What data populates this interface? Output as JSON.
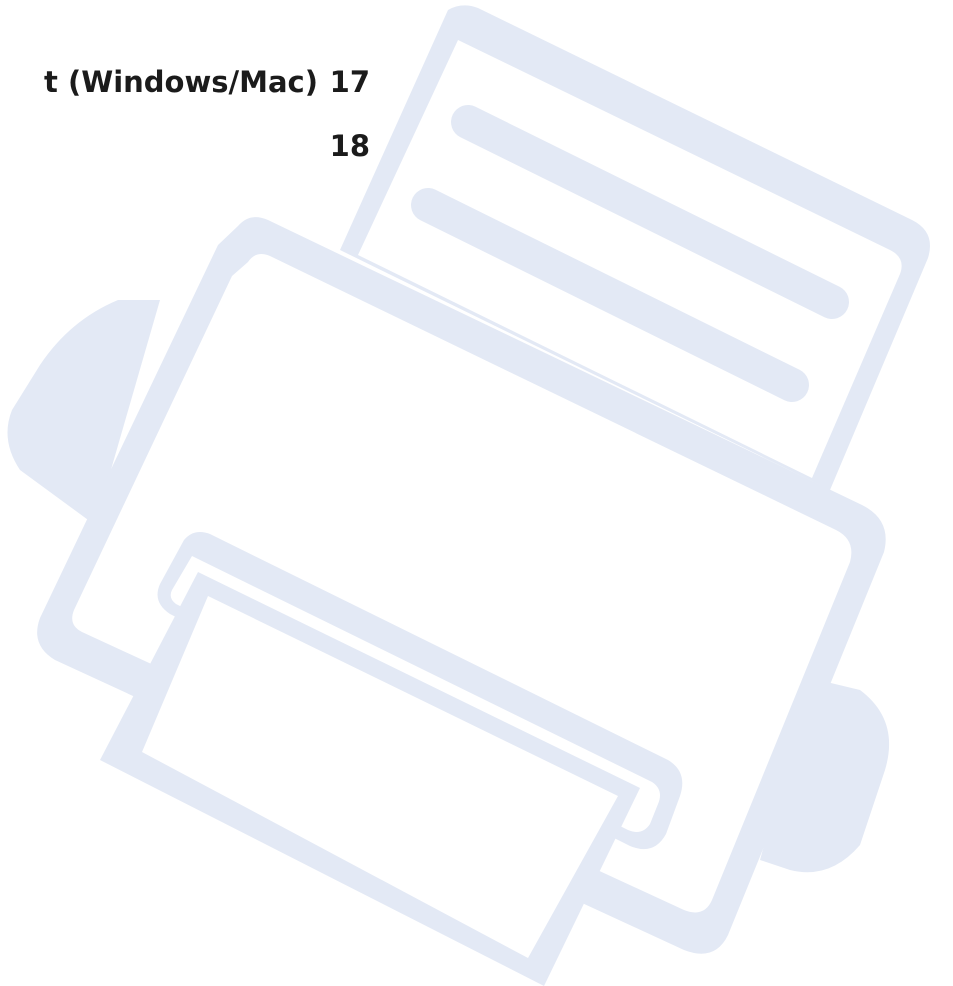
{
  "toc": {
    "entries": [
      {
        "title": "t (Windows/Mac)",
        "page": "17"
      },
      {
        "title": "",
        "page": "18"
      }
    ]
  },
  "illustration": {
    "icon": "printer-icon",
    "color": "#e3e9f5"
  }
}
